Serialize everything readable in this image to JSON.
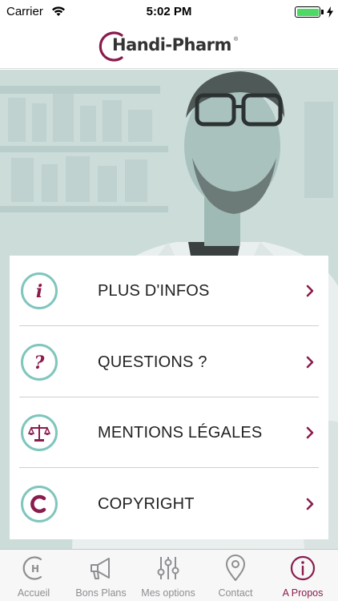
{
  "status_bar": {
    "carrier": "Carrier",
    "time": "5:02 PM",
    "battery_level": 1.0,
    "wifi_icon": "wifi-icon",
    "charging_icon": "bolt-icon"
  },
  "header": {
    "logo_text": "Handi-Pharm",
    "logo_reg": "®"
  },
  "colors": {
    "brand": "#8a1c4d",
    "accent_teal": "#7fc6be",
    "tab_inactive": "#8e8e93"
  },
  "menu": {
    "items": [
      {
        "label": "PLUS D'INFOS",
        "icon": "info-icon"
      },
      {
        "label": "QUESTIONS ?",
        "icon": "question-icon"
      },
      {
        "label": "MENTIONS LÉGALES",
        "icon": "scales-icon"
      },
      {
        "label": "COPYRIGHT",
        "icon": "copyright-icon"
      }
    ]
  },
  "tabs": [
    {
      "label": "Accueil",
      "icon": "home-h-icon",
      "active": false
    },
    {
      "label": "Bons Plans",
      "icon": "megaphone-icon",
      "active": false
    },
    {
      "label": "Mes options",
      "icon": "sliders-icon",
      "active": false
    },
    {
      "label": "Contact",
      "icon": "location-pin-icon",
      "active": false
    },
    {
      "label": "A Propos",
      "icon": "info-circle-icon",
      "active": true
    }
  ]
}
